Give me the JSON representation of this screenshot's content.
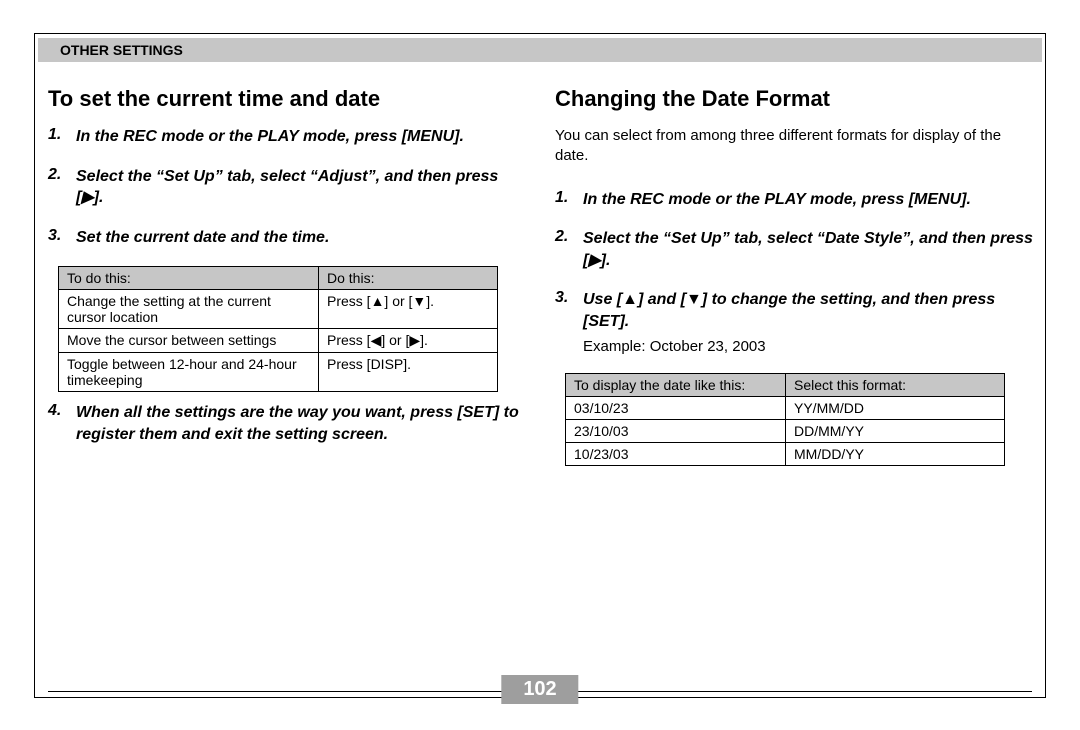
{
  "header": {
    "section": "OTHER SETTINGS"
  },
  "page_number": "102",
  "left": {
    "title": "To set the current time and date",
    "steps": [
      {
        "text": "In the REC mode or the PLAY mode, press [MENU]."
      },
      {
        "text": "Select the “Set Up” tab, select “Adjust”, and then press [▶]."
      },
      {
        "text": "Set the current date and the time."
      },
      {
        "text": "When all the settings are the way you want, press [SET] to register them and exit the setting screen."
      }
    ],
    "table": {
      "headers": [
        "To do this:",
        "Do this:"
      ],
      "rows": [
        [
          "Change the setting at the current cursor location",
          "Press [▲] or [▼]."
        ],
        [
          "Move the cursor between settings",
          "Press [◀] or [▶]."
        ],
        [
          "Toggle between 12-hour and 24-hour timekeeping",
          "Press [DISP]."
        ]
      ]
    }
  },
  "right": {
    "title": "Changing the Date Format",
    "intro": "You can select from among three different formats for display of the date.",
    "steps": [
      {
        "text": "In the REC mode or the PLAY mode, press [MENU]."
      },
      {
        "text": "Select the “Set Up” tab, select “Date Style”, and then press [▶]."
      },
      {
        "text": "Use [▲] and [▼] to change the setting, and then press [SET].",
        "sub": "Example: October 23, 2003"
      }
    ],
    "table": {
      "headers": [
        "To display the date like this:",
        "Select this format:"
      ],
      "rows": [
        [
          "03/10/23",
          "YY/MM/DD"
        ],
        [
          "23/10/03",
          "DD/MM/YY"
        ],
        [
          "10/23/03",
          "MM/DD/YY"
        ]
      ]
    }
  }
}
